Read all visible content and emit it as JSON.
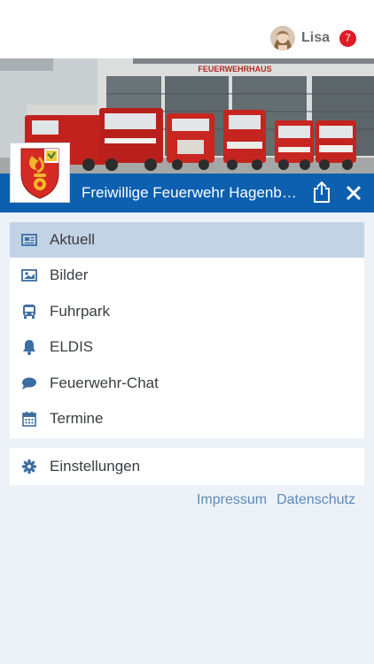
{
  "user": {
    "name": "Lisa",
    "notification_count": "7",
    "avatar_icon": "user-avatar-photo"
  },
  "header": {
    "station_sign": "FEUERWEHRHAUS",
    "department_name": "Freiwillige Feuerwehr Hagenb…",
    "share_icon": "share-icon",
    "close_icon": "close-icon"
  },
  "menu": {
    "items": [
      {
        "label": "Aktuell",
        "icon": "newspaper-icon",
        "active": true
      },
      {
        "label": "Bilder",
        "icon": "image-icon",
        "active": false
      },
      {
        "label": "Fuhrpark",
        "icon": "bus-icon",
        "active": false
      },
      {
        "label": "ELDIS",
        "icon": "bell-icon",
        "active": false
      },
      {
        "label": "Feuerwehr-Chat",
        "icon": "chat-bubble-icon",
        "active": false
      },
      {
        "label": "Termine",
        "icon": "calendar-icon",
        "active": false
      }
    ],
    "settings": {
      "label": "Einstellungen",
      "icon": "gear-icon"
    }
  },
  "footer": {
    "impressum": "Impressum",
    "datenschutz": "Datenschutz"
  },
  "colors": {
    "brand_blue": "#0d5fb0",
    "active_item": "#c3d3e6",
    "icon_blue": "#3d6ea3",
    "badge_red": "#dd1c23",
    "link": "#5b8bb8",
    "background": "#edf1f8"
  }
}
